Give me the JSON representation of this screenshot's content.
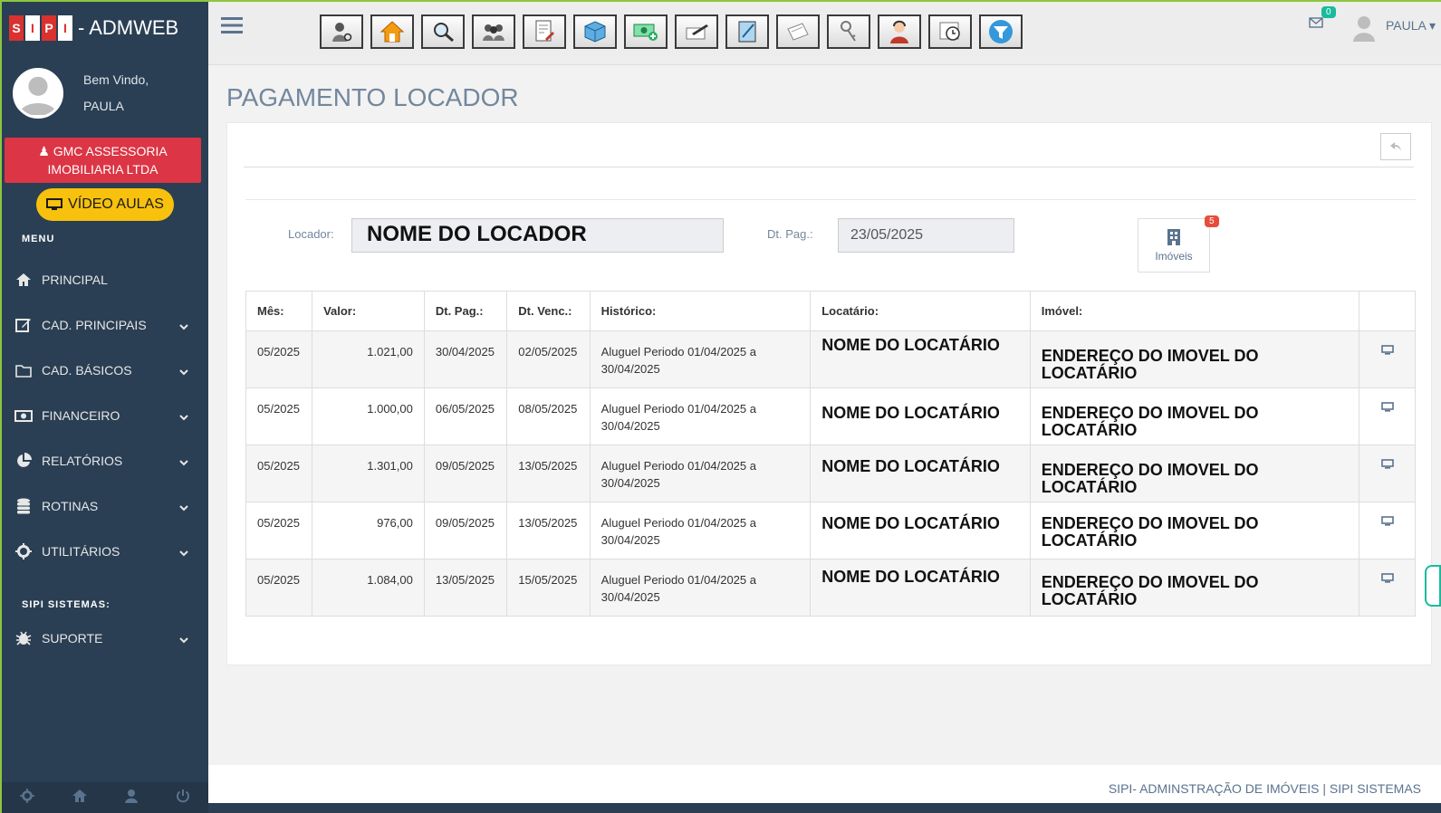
{
  "brand": {
    "letters": [
      "S",
      "I",
      "P",
      "I"
    ],
    "title": "- ADMWEB"
  },
  "profile": {
    "greeting": "Bem Vindo,",
    "user": "PAULA"
  },
  "company": "GMC ASSESSORIA IMOBILIARIA LTDA",
  "video_button": "VÍDEO AULAS",
  "menu_title": "MENU",
  "nav": [
    {
      "label": "PRINCIPAL",
      "icon": "home-icon"
    },
    {
      "label": "CAD. PRINCIPAIS",
      "icon": "edit-icon"
    },
    {
      "label": "CAD. BÁSICOS",
      "icon": "folder-icon"
    },
    {
      "label": "FINANCEIRO",
      "icon": "money-icon"
    },
    {
      "label": "RELATÓRIOS",
      "icon": "pie-chart-icon"
    },
    {
      "label": "ROTINAS",
      "icon": "database-icon"
    },
    {
      "label": "UTILITÁRIOS",
      "icon": "gear-icon"
    }
  ],
  "section_title": "SIPI SISTEMAS:",
  "support": {
    "label": "SUPORTE",
    "icon": "bug-icon"
  },
  "topbar": {
    "mail_count": "0",
    "user": "PAULA"
  },
  "page": {
    "title": "PAGAMENTO LOCADOR",
    "locador_label": "Locador:",
    "locador_value": "NOME DO LOCADOR",
    "dtpag_label": "Dt. Pag.:",
    "dtpag_value": "23/05/2025",
    "imoveis_label": "Imóveis",
    "imoveis_count": "5"
  },
  "table": {
    "headers": [
      "Mês:",
      "Valor:",
      "Dt. Pag.:",
      "Dt. Venc.:",
      "Histórico:",
      "Locatário:",
      "Imóvel:"
    ],
    "rows": [
      {
        "mes": "05/2025",
        "valor": "1.021,00",
        "dtpag": "30/04/2025",
        "dtvenc": "02/05/2025",
        "hist": "Aluguel Periodo 01/04/2025 a 30/04/2025",
        "locatario": "NOME DO LOCATÁRIO",
        "imovel": "ENDEREÇO DO IMOVEL DO LOCATÁRIO"
      },
      {
        "mes": "05/2025",
        "valor": "1.000,00",
        "dtpag": "06/05/2025",
        "dtvenc": "08/05/2025",
        "hist": "Aluguel Periodo 01/04/2025 a 30/04/2025",
        "locatario": "NOME DO LOCATÁRIO",
        "imovel": "ENDEREÇO DO IMOVEL DO LOCATÁRIO"
      },
      {
        "mes": "05/2025",
        "valor": "1.301,00",
        "dtpag": "09/05/2025",
        "dtvenc": "13/05/2025",
        "hist": "Aluguel Periodo 01/04/2025 a 30/04/2025",
        "locatario": "NOME DO LOCATÁRIO",
        "imovel": "ENDEREÇO DO IMOVEL DO LOCATÁRIO"
      },
      {
        "mes": "05/2025",
        "valor": "976,00",
        "dtpag": "09/05/2025",
        "dtvenc": "13/05/2025",
        "hist": "Aluguel Periodo 01/04/2025 a 30/04/2025",
        "locatario": "NOME DO LOCATÁRIO",
        "imovel": "ENDEREÇO DO IMOVEL DO LOCATÁRIO"
      },
      {
        "mes": "05/2025",
        "valor": "1.084,00",
        "dtpag": "13/05/2025",
        "dtvenc": "15/05/2025",
        "hist": "Aluguel Periodo 01/04/2025 a 30/04/2025",
        "locatario": "NOME DO LOCATÁRIO",
        "imovel": "ENDEREÇO DO IMOVEL DO LOCATÁRIO"
      }
    ]
  },
  "footer": "SIPI- ADMINSTRAÇÃO DE IMÓVEIS | SIPI SISTEMAS",
  "colors": {
    "sidebar": "#2a3f54",
    "accent": "#8cc63f",
    "company": "#dc3545",
    "video": "#f7c10e",
    "badge_green": "#1abb9c",
    "badge_red": "#e74c3c"
  }
}
